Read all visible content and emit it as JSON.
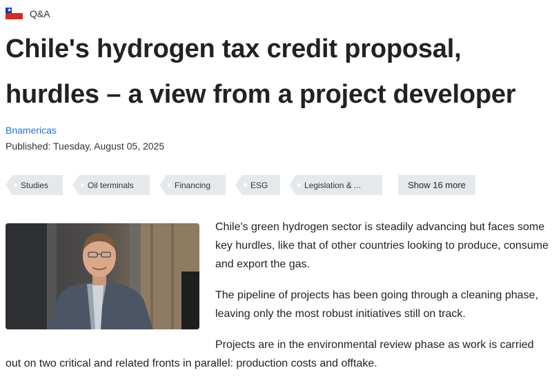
{
  "section": {
    "label": "Q&A",
    "flag_icon": "chile-flag-icon"
  },
  "article": {
    "title": "Chile's hydrogen tax credit proposal, hurdles – a view from a project developer",
    "source": "Bnamericas",
    "published": "Published: Tuesday, August 05, 2025"
  },
  "tags": {
    "items": [
      {
        "label": "Studies"
      },
      {
        "label": "Oil terminals"
      },
      {
        "label": "Financing"
      },
      {
        "label": "ESG"
      },
      {
        "label": "Legislation & ..."
      }
    ],
    "show_more_label": "Show 16 more"
  },
  "body": {
    "paragraphs": [
      "Chile's green hydrogen sector is steadily advancing but faces some key hurdles, like that of other countries looking to produce, consume and export the gas.",
      "The pipeline of projects has been going through a cleaning phase, leaving only the most robust initiatives still on track.",
      "Projects are in the environmental review phase as work is carried out on two critical and related fronts in parallel: production costs and offtake."
    ]
  },
  "colors": {
    "link": "#1a73d9",
    "tag_bg": "#e6e9ec",
    "text": "#222222"
  }
}
